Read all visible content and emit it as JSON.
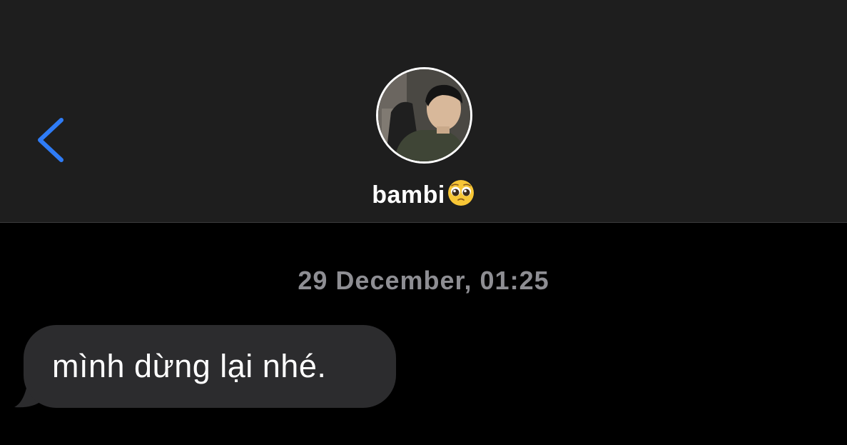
{
  "header": {
    "back_icon": "chevron-left-icon",
    "contact": {
      "name": "bambi",
      "emoji": "pleading-face-emoji",
      "avatar": "profile-photo"
    }
  },
  "conversation": {
    "timestamp": "29 December, 01:25",
    "messages": [
      {
        "direction": "incoming",
        "text": "mình dừng lại nhé."
      }
    ]
  },
  "colors": {
    "accent": "#2f7cf6",
    "header_bg": "#1e1e1e",
    "page_bg": "#000000",
    "bubble_bg": "#2c2c2e",
    "timestamp": "#8e8e93",
    "text": "#ffffff"
  }
}
